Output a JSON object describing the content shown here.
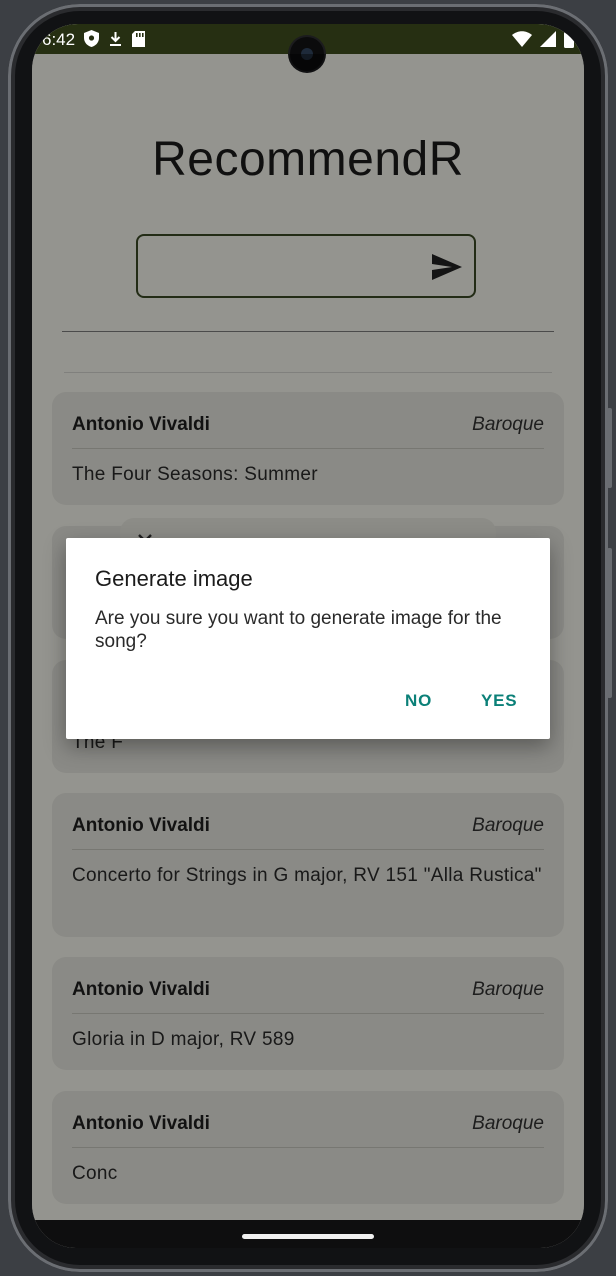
{
  "status_bar": {
    "time": "6:42",
    "left_icons": [
      "shield-icon",
      "download-arrow-icon",
      "sd-card-icon"
    ],
    "right_icons": [
      "wifi-icon",
      "signal-icon",
      "battery-icon"
    ]
  },
  "app": {
    "title": "RecommendR",
    "search": {
      "value": "",
      "placeholder": ""
    },
    "send_icon": "send-icon"
  },
  "cards": [
    {
      "artist": "Antonio Vivaldi",
      "genre": "Baroque",
      "title": "The Four Seasons: Summer"
    },
    {
      "artist": "",
      "genre": "",
      "title": ""
    },
    {
      "artist": "",
      "genre": "",
      "title": "The F"
    },
    {
      "artist": "Antonio Vivaldi",
      "genre": "Baroque",
      "title": "Concerto for Strings in G major, RV 151 \"Alla Rustica\""
    },
    {
      "artist": "Antonio Vivaldi",
      "genre": "Baroque",
      "title": "Gloria in D major, RV 589"
    },
    {
      "artist": "Antonio Vivaldi",
      "genre": "Baroque",
      "title": "Conc"
    }
  ],
  "dialog": {
    "title": "Generate image",
    "message": "Are you sure you want to generate image for the song?",
    "no_label": "NO",
    "yes_label": "YES"
  },
  "colors": {
    "accent": "#0b8078",
    "status_bar": "#262f12",
    "card_bg": "#e7e7df",
    "screen_bg": "#f7f7ef"
  }
}
